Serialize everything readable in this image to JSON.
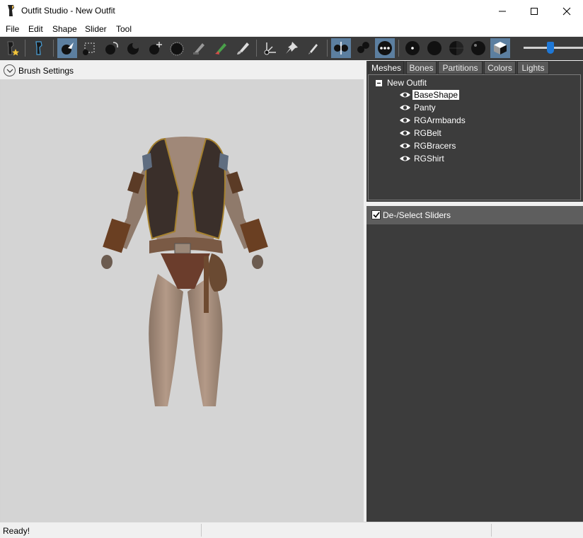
{
  "window": {
    "title": "Outfit Studio - New Outfit"
  },
  "menu": {
    "items": [
      "File",
      "Edit",
      "Shape",
      "Slider",
      "Tool"
    ]
  },
  "toolbar": {
    "icons": [
      "new-project-icon",
      "load-outfit-icon",
      "select-brush-icon",
      "box-select-icon",
      "inflate-brush-icon",
      "deflate-brush-icon",
      "move-brush-icon",
      "smooth-brush-icon",
      "mask-brush-icon",
      "weight-brush-icon",
      "color-brush-icon",
      "transform-icon",
      "pivot-icon",
      "vertex-edit-icon",
      "x-mirror-icon",
      "connected-only-icon",
      "global-brush-icon",
      "vertices-icon",
      "flat-shading-icon",
      "wireframe-icon",
      "lighting-icon",
      "textures-icon"
    ],
    "zoom_level": 0.45
  },
  "left_panel": {
    "brush_settings_label": "Brush Settings"
  },
  "right_panel": {
    "tabs": [
      "Meshes",
      "Bones",
      "Partitions",
      "Colors",
      "Lights"
    ],
    "active_tab": "Meshes",
    "tree": {
      "root": "New Outfit",
      "items": [
        "BaseShape",
        "Panty",
        "RGArmbands",
        "RGBelt",
        "RGBracers",
        "RGShirt"
      ],
      "selected": "BaseShape"
    },
    "sliders_label": "De-/Select Sliders",
    "sliders_checked": true
  },
  "status": {
    "text": "Ready!"
  },
  "colors": {
    "dark_panel": "#3c3c3c",
    "toolbar_bg": "#3b3b3b",
    "active_tool": "#5c7fa0",
    "viewport_bg": "#d4d4d4",
    "accent_blue": "#1e78d7"
  }
}
